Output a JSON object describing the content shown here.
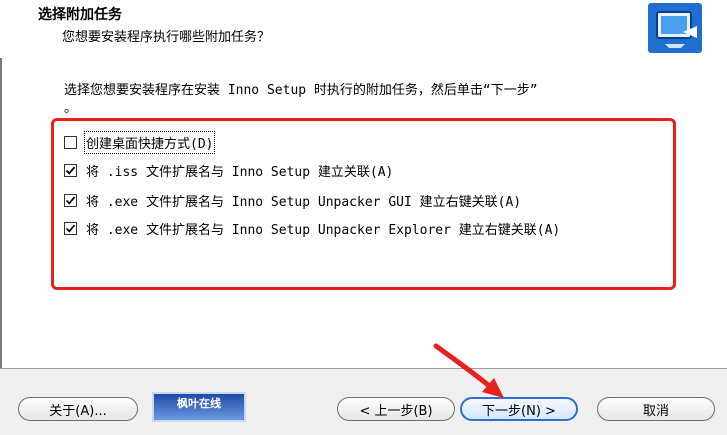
{
  "header": {
    "title": "选择附加任务",
    "subtitle": "您想要安装程序执行哪些附加任务？"
  },
  "description": {
    "line1": "选择您想要安装程序在安装 Inno Setup 时执行的附加任务，然后单击“下一步”",
    "line2": "。"
  },
  "tasks": [
    {
      "label": "创建桌面快捷方式(D)",
      "checked": false
    },
    {
      "label": "将 .iss 文件扩展名与 Inno Setup 建立关联(A)",
      "checked": true
    },
    {
      "label": "将 .exe 文件扩展名与 Inno Setup Unpacker GUI 建立右键关联(A)",
      "checked": true
    },
    {
      "label": "将 .exe 文件扩展名与 Inno Setup Unpacker Explorer 建立右键关联(A)",
      "checked": true
    }
  ],
  "buttons": {
    "about": "关于(A)...",
    "back": "< 上一步(B)",
    "next": "下一步(N) >",
    "cancel": "取消"
  },
  "watermark": "枫叶在线",
  "colors": {
    "highlight_frame": "#e8201e",
    "primary_button_border": "#2b6ed1"
  }
}
